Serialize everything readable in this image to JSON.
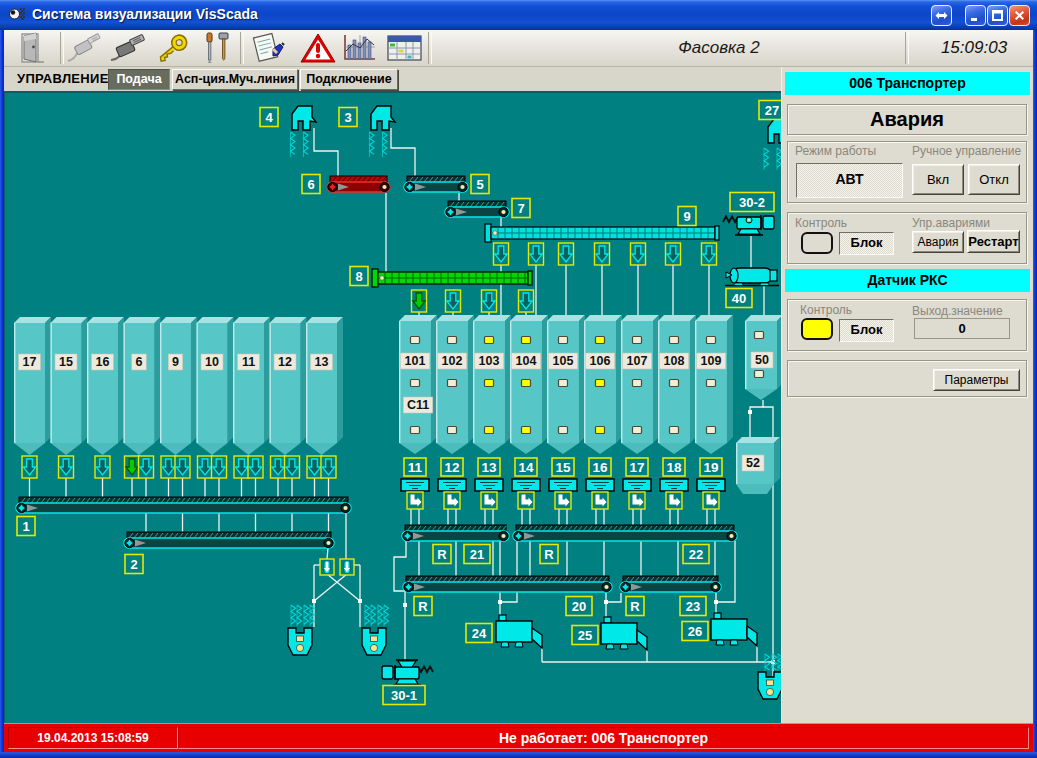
{
  "window": {
    "title": "Система визуализации VisScada",
    "buttons": {
      "resize": "resize",
      "minimize": "minimize",
      "maximize": "maximize",
      "close": "close"
    }
  },
  "toolbar": {
    "icons": [
      "exit-door",
      "cable-unplugged",
      "cable-plugged",
      "access-key",
      "tools-setup",
      "report-journal",
      "alarm-warning",
      "trends-chart",
      "data-table"
    ],
    "screen_label": "Фасовка 2",
    "clock": "15:09:03"
  },
  "tabs": {
    "menu_label": "УПРАВЛЕНИЕ",
    "items": [
      {
        "label": "Подача",
        "active": true
      },
      {
        "label": "Асп-ция.Муч.линия",
        "active": false
      },
      {
        "label": "Подключение",
        "active": false
      }
    ]
  },
  "canvas": {
    "silos_left": [
      "17",
      "15",
      "16",
      "6",
      "9",
      "10",
      "11",
      "12",
      "13"
    ],
    "silos_right": [
      {
        "label": "101",
        "lamps": [
          "w",
          "w",
          "w"
        ]
      },
      {
        "label": "102",
        "lamps": [
          "w",
          "w",
          "w"
        ]
      },
      {
        "label": "103",
        "lamps": [
          "y",
          "y",
          "y"
        ]
      },
      {
        "label": "104",
        "lamps": [
          "y",
          "y",
          "y"
        ]
      },
      {
        "label": "105",
        "lamps": [
          "w",
          "w",
          "w"
        ]
      },
      {
        "label": "106",
        "lamps": [
          "y",
          "y",
          "y"
        ]
      },
      {
        "label": "107",
        "lamps": [
          "w",
          "w",
          "w"
        ]
      },
      {
        "label": "108",
        "lamps": [
          "w",
          "w",
          "w"
        ]
      },
      {
        "label": "109",
        "lamps": [
          "w",
          "w",
          "w"
        ]
      }
    ],
    "c11_label": "C11",
    "silo50": {
      "label": "50",
      "lamps": [
        "w",
        "w"
      ]
    },
    "bin52": {
      "label": "52"
    },
    "hopper_labels": [
      "4",
      "3",
      "27"
    ],
    "conveyor_labels": {
      "c1": "1",
      "c2": "2",
      "c5": "5",
      "c6": "6",
      "c7": "7",
      "c8": "8",
      "c9": "9"
    },
    "machine_labels": {
      "m302": "30-2",
      "fan40": "40",
      "m301": "30-1",
      "p24": "24",
      "p25": "25",
      "p26": "26"
    },
    "scale_units": [
      "11",
      "12",
      "13",
      "14",
      "15",
      "16",
      "17",
      "18",
      "19"
    ],
    "belt_tags": {
      "a": [
        "R",
        "21"
      ],
      "b": [
        "R",
        "22"
      ],
      "c": [
        "R",
        "20"
      ],
      "d": [
        "R",
        "23"
      ]
    }
  },
  "panel": {
    "header_transporter": "006 Транспортер",
    "status_text": "Авария",
    "mode_label": "Режим работы",
    "mode_value": "АВТ",
    "manual_label": "Ручное управление",
    "btn_on": "Вкл",
    "btn_off": "Откл",
    "control_label": "Контроль",
    "block_label": "Блок",
    "alarm_group_label": "Упр.авариями",
    "btn_alarm": "Авария",
    "btn_restart": "Рестарт",
    "header_sensor": "Датчик РКС",
    "sensor_control_label": "Контроль",
    "sensor_block_label": "Блок",
    "out_label": "Выход.значение",
    "out_value": "0",
    "btn_params": "Параметры"
  },
  "statusbar": {
    "datetime": "19.04.2013 15:08:59",
    "message": "Не работает: 006 Транспортер"
  },
  "colors": {
    "canvas_bg": "#008080",
    "alarm_red": "#e80000",
    "header_cyan": "#00ffff",
    "machine_cyan": "#00e8e8",
    "label_yellow_border": "#e8e800",
    "lamp_yellow": "#ffff00",
    "conveyor_fault_red": "#a80404",
    "screw_green": "#00d800"
  }
}
